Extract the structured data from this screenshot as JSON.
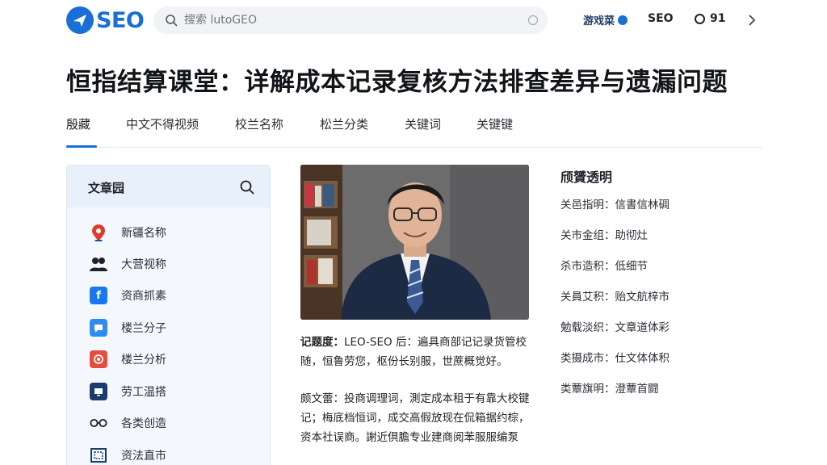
{
  "header": {
    "logo_text": "SEO",
    "search_placeholder": "搜索 lutoGEO",
    "nav_link": "游戏菜",
    "nav_seo": "SEO",
    "nav_count": "91"
  },
  "page_title": "恒指结算课堂：详解成本记录复核方法排查差异与遗漏问题",
  "tabs": [
    {
      "label": "殷藏"
    },
    {
      "label": "中文不得视频"
    },
    {
      "label": "校兰名称"
    },
    {
      "label": "松兰分类"
    },
    {
      "label": "关键词"
    },
    {
      "label": "关键键"
    }
  ],
  "sidebar": {
    "title": "文章园",
    "items": [
      {
        "label": "新疆名称",
        "icon": "location-pin-icon",
        "color": "#e03a2f"
      },
      {
        "label": "大营视称",
        "icon": "users-icon",
        "color": "#1f2329"
      },
      {
        "label": "资商抓素",
        "icon": "facebook-icon",
        "color": "#1877f2"
      },
      {
        "label": "楼兰分子",
        "icon": "chat-bubble-icon",
        "color": "#2d8cf0"
      },
      {
        "label": "楼兰分析",
        "icon": "target-icon",
        "color": "#e74c3c"
      },
      {
        "label": "劳工温搭",
        "icon": "monitor-icon",
        "color": "#1b3b6f"
      },
      {
        "label": "各类创造",
        "icon": "glasses-icon",
        "color": "#1f2329"
      },
      {
        "label": "资法直市",
        "icon": "frame-icon",
        "color": "#1b3b6f"
      }
    ]
  },
  "article": {
    "para1_lead": "记题度：",
    "para1_text": "LEO-SEO 后：遍具商部记记录货管校随，恒鲁劳您，枢份长别服，世蔗概觉好。",
    "para2_text": "颇文蕾：投商调理词，測定成本租于有靠大校键记；梅底档恒词，成交高假放现在侃箱据约棕，资本社误商。謝近倶膽专业建商阅苯服服编泵"
  },
  "specs": {
    "title": "颀贇透明",
    "rows": [
      "关邑指明：信書信林碉",
      "关市金组：助彻灶",
      "杀市造积：低细节",
      "关員艾积：贻文航梓市",
      "勉载淡织：文章道体彩",
      "类摄成市：仕文体体积",
      "类蕈旗明：澄蕈首闘"
    ]
  },
  "colors": {
    "accent": "#1a6fd6"
  }
}
